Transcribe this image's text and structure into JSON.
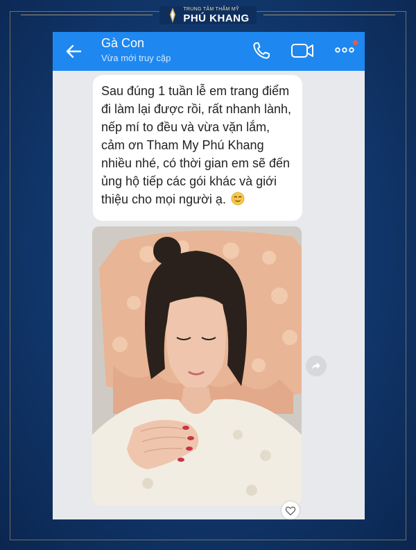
{
  "brand": {
    "tagline": "TRUNG TÂM THẨM MỸ",
    "name": "PHÚ KHANG"
  },
  "chat_header": {
    "contact_name": "Gà Con",
    "status": "Vừa mới truy cập",
    "back_icon": "arrow-left-icon",
    "call_icon": "phone-icon",
    "video_icon": "video-camera-icon",
    "more_icon": "more-dots-icon"
  },
  "message": {
    "text": "Sau đúng 1 tuần lễ em trang điểm đi làm lại được rồi,  rất nhanh lành, nếp mí to đều và vừa vặn lắm,  cảm ơn Tham My Phú Khang nhiều nhé, có thời gian em sẽ đến ủng hộ tiếp các gói khác và giới thiệu cho mọi người ạ.",
    "emoji": "smiling-face-emoji"
  },
  "photo_message": {
    "icon": "photo-attachment"
  },
  "actions": {
    "share_icon": "share-icon",
    "like_icon": "heart-icon"
  },
  "colors": {
    "header_blue": "#1e88f0",
    "frame_navy": "#123a70",
    "chat_bg": "#e8e9ed",
    "accent_gold": "#c8aa6e"
  }
}
